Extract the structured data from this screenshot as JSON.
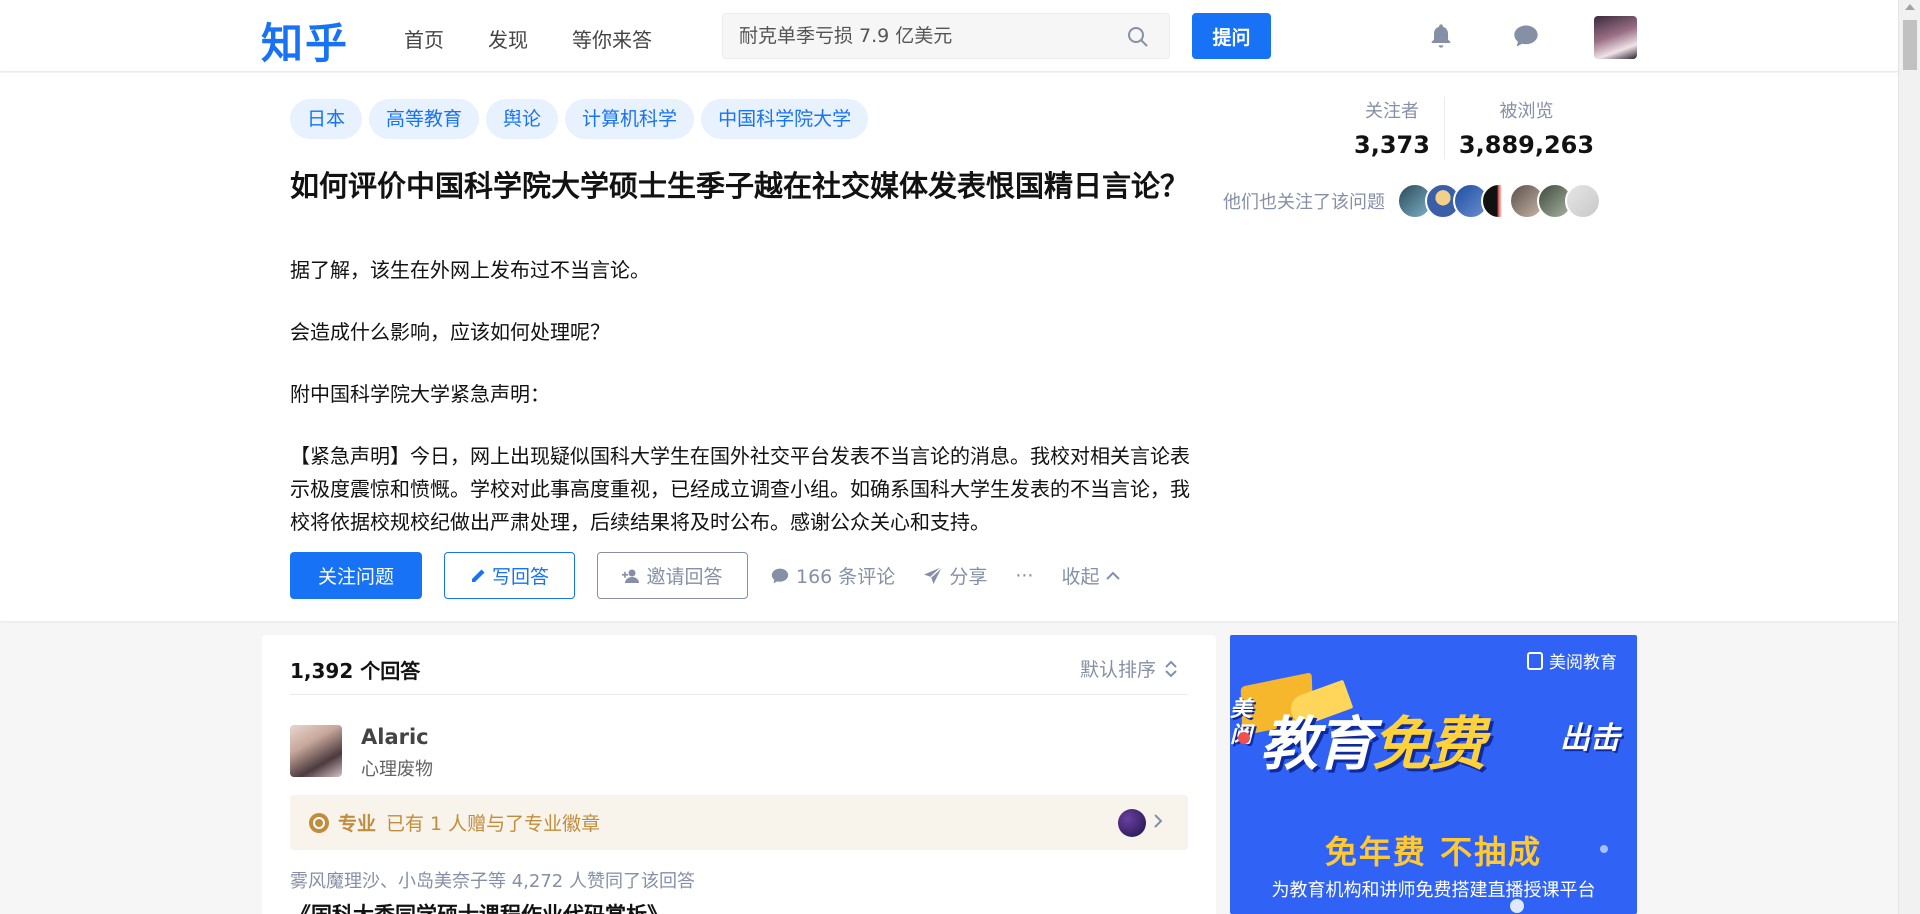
{
  "brand": {
    "logo": "知乎"
  },
  "nav": {
    "items": [
      {
        "label": "首页"
      },
      {
        "label": "发现"
      },
      {
        "label": "等你来答"
      }
    ]
  },
  "search": {
    "placeholder": "耐克单季亏损 7.9 亿美元"
  },
  "header": {
    "ask_label": "提问"
  },
  "question": {
    "topics": [
      "日本",
      "高等教育",
      "舆论",
      "计算机科学",
      "中国科学院大学"
    ],
    "title": "如何评价中国科学院大学硕士生季子越在社交媒体发表恨国精日言论？",
    "body": [
      "据了解，该生在外网上发布过不当言论。",
      "会造成什么影响，应该如何处理呢？",
      "附中国科学院大学紧急声明：",
      "【紧急声明】今日，网上出现疑似国科大学生在国外社交平台发表不当言论的消息。我校对相关言论表示极度震惊和愤慨。学校对此事高度重视，已经成立调查小组。如确系国科大学生发表的不当言论，我校将依据校规校纪做出严肃处理，后续结果将及时公布。感谢公众关心和支持。"
    ],
    "actions": {
      "follow": "关注问题",
      "write": "写回答",
      "invite": "邀请回答",
      "comments": "166 条评论",
      "share": "分享",
      "more": "···",
      "collapse": "收起"
    },
    "stats": {
      "followers_label": "关注者",
      "followers": "3,373",
      "views_label": "被浏览",
      "views": "3,889,263"
    },
    "also_followed": "他们也关注了该问题"
  },
  "answers": {
    "count": "1,392 个回答",
    "sort": "默认排序",
    "first": {
      "author": "Alaric",
      "bio": "心理废物",
      "badge_label": "专业",
      "badge_text": "已有 1 人赠与了专业徽章",
      "voters": "雾风魔理沙、小岛美奈子等 4,272 人赞同了该回答",
      "next_line": "《国科大季同学硕士课程作业代码赏析》"
    }
  },
  "ad": {
    "brand": "美阅教育",
    "small": "美阅",
    "headline_a": "教育",
    "headline_b": "免费",
    "headline_c": "出击",
    "sub": "免年费  不抽成",
    "tagline": "为教育机构和讲师免费搭建直播授课平台"
  },
  "colors": {
    "accent": "#1772f6",
    "muted": "#8590a6",
    "gold": "#c18d3d",
    "ad_bg": "#2f62f5"
  }
}
